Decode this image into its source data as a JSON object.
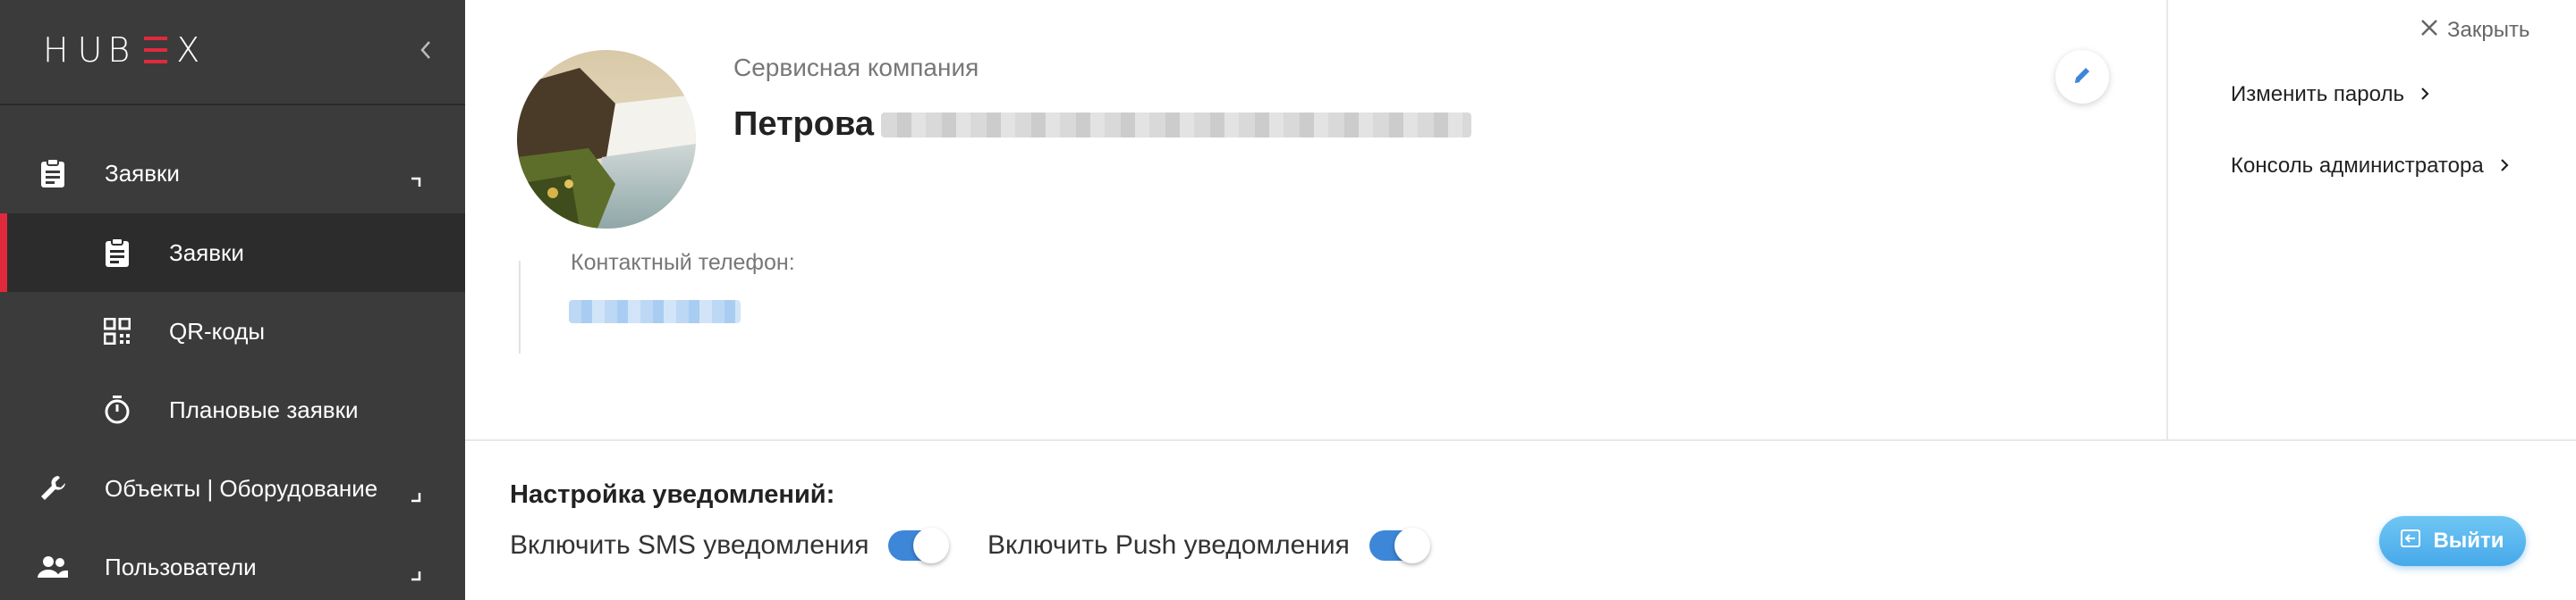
{
  "app": {
    "logo_text_left": "H",
    "logo_text_mid": "UB",
    "logo_text_right": "X",
    "accent": "#e02a3c"
  },
  "sidebar": {
    "collapse_icon": "chevron-left-icon",
    "items": [
      {
        "label": "Заявки",
        "icon": "clipboard-icon",
        "caret": "collapse-caret-icon",
        "sub": false,
        "active": false
      },
      {
        "label": "Заявки",
        "icon": "clipboard-icon",
        "sub": true,
        "active": true
      },
      {
        "label": "QR-коды",
        "icon": "qr-code-icon",
        "sub": true,
        "active": false
      },
      {
        "label": "Плановые заявки",
        "icon": "timer-icon",
        "sub": true,
        "active": false
      },
      {
        "label": "Объекты | Оборудование",
        "icon": "wrench-icon",
        "caret": "expand-caret-icon",
        "sub": false,
        "active": false
      },
      {
        "label": "Пользователи",
        "icon": "users-icon",
        "caret": "expand-caret-icon",
        "sub": false,
        "active": false
      }
    ]
  },
  "profile": {
    "company": "Сервисная компания",
    "name": "Петрова",
    "phone_label": "Контактный телефон:",
    "edit_icon": "pencil-icon"
  },
  "right_panel": {
    "close_label": "Закрыть",
    "links": [
      {
        "label": "Изменить пароль"
      },
      {
        "label": "Консоль администратора"
      }
    ]
  },
  "notifications": {
    "title": "Настройка уведомлений:",
    "sms_label": "Включить SMS уведомления",
    "sms_enabled": true,
    "push_label": "Включить Push уведомления",
    "push_enabled": true
  },
  "logout": {
    "label": "Выйти",
    "icon": "logout-icon"
  },
  "colors": {
    "sidebar_bg": "#3b3b3b",
    "primary": "#3d86d8",
    "logout": "#47a9ea"
  }
}
